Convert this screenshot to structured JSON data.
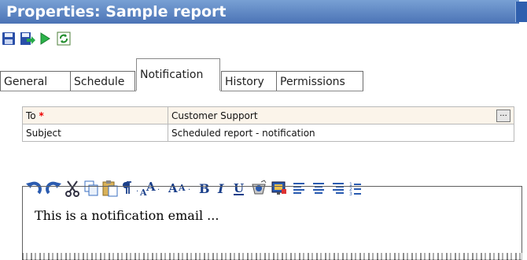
{
  "window": {
    "title": "Properties: Sample report"
  },
  "toolbar": {
    "icons": [
      "save-icon",
      "save-and-close-icon",
      "run-icon",
      "refresh-icon"
    ]
  },
  "tabs": [
    {
      "label": "General",
      "active": false
    },
    {
      "label": "Schedule",
      "active": false
    },
    {
      "label": "Notification",
      "active": true
    },
    {
      "label": "History",
      "active": false
    },
    {
      "label": "Permissions",
      "active": false
    }
  ],
  "form": {
    "to_label": "To",
    "to_required_marker": "*",
    "to_value": "Customer Support",
    "to_button": "...",
    "subject_label": "Subject",
    "subject_value": "Scheduled report - notification"
  },
  "editor_toolbar": {
    "icons": [
      "undo-icon",
      "redo-icon",
      "cut-icon",
      "copy-icon",
      "paste-icon",
      "paragraph-icon",
      "font-size-increase-icon",
      "font-size-decrease-icon",
      "bold-icon",
      "italic-icon",
      "underline-icon",
      "insert-image-icon",
      "insert-media-icon",
      "align-left-icon",
      "align-center-icon",
      "align-right-icon",
      "ordered-list-icon"
    ]
  },
  "editor": {
    "body": "This is a notification email ..."
  },
  "colors": {
    "title_bar": "#4b73b6",
    "required": "#ee0000",
    "to_row_bg": "#fbf4ea"
  }
}
